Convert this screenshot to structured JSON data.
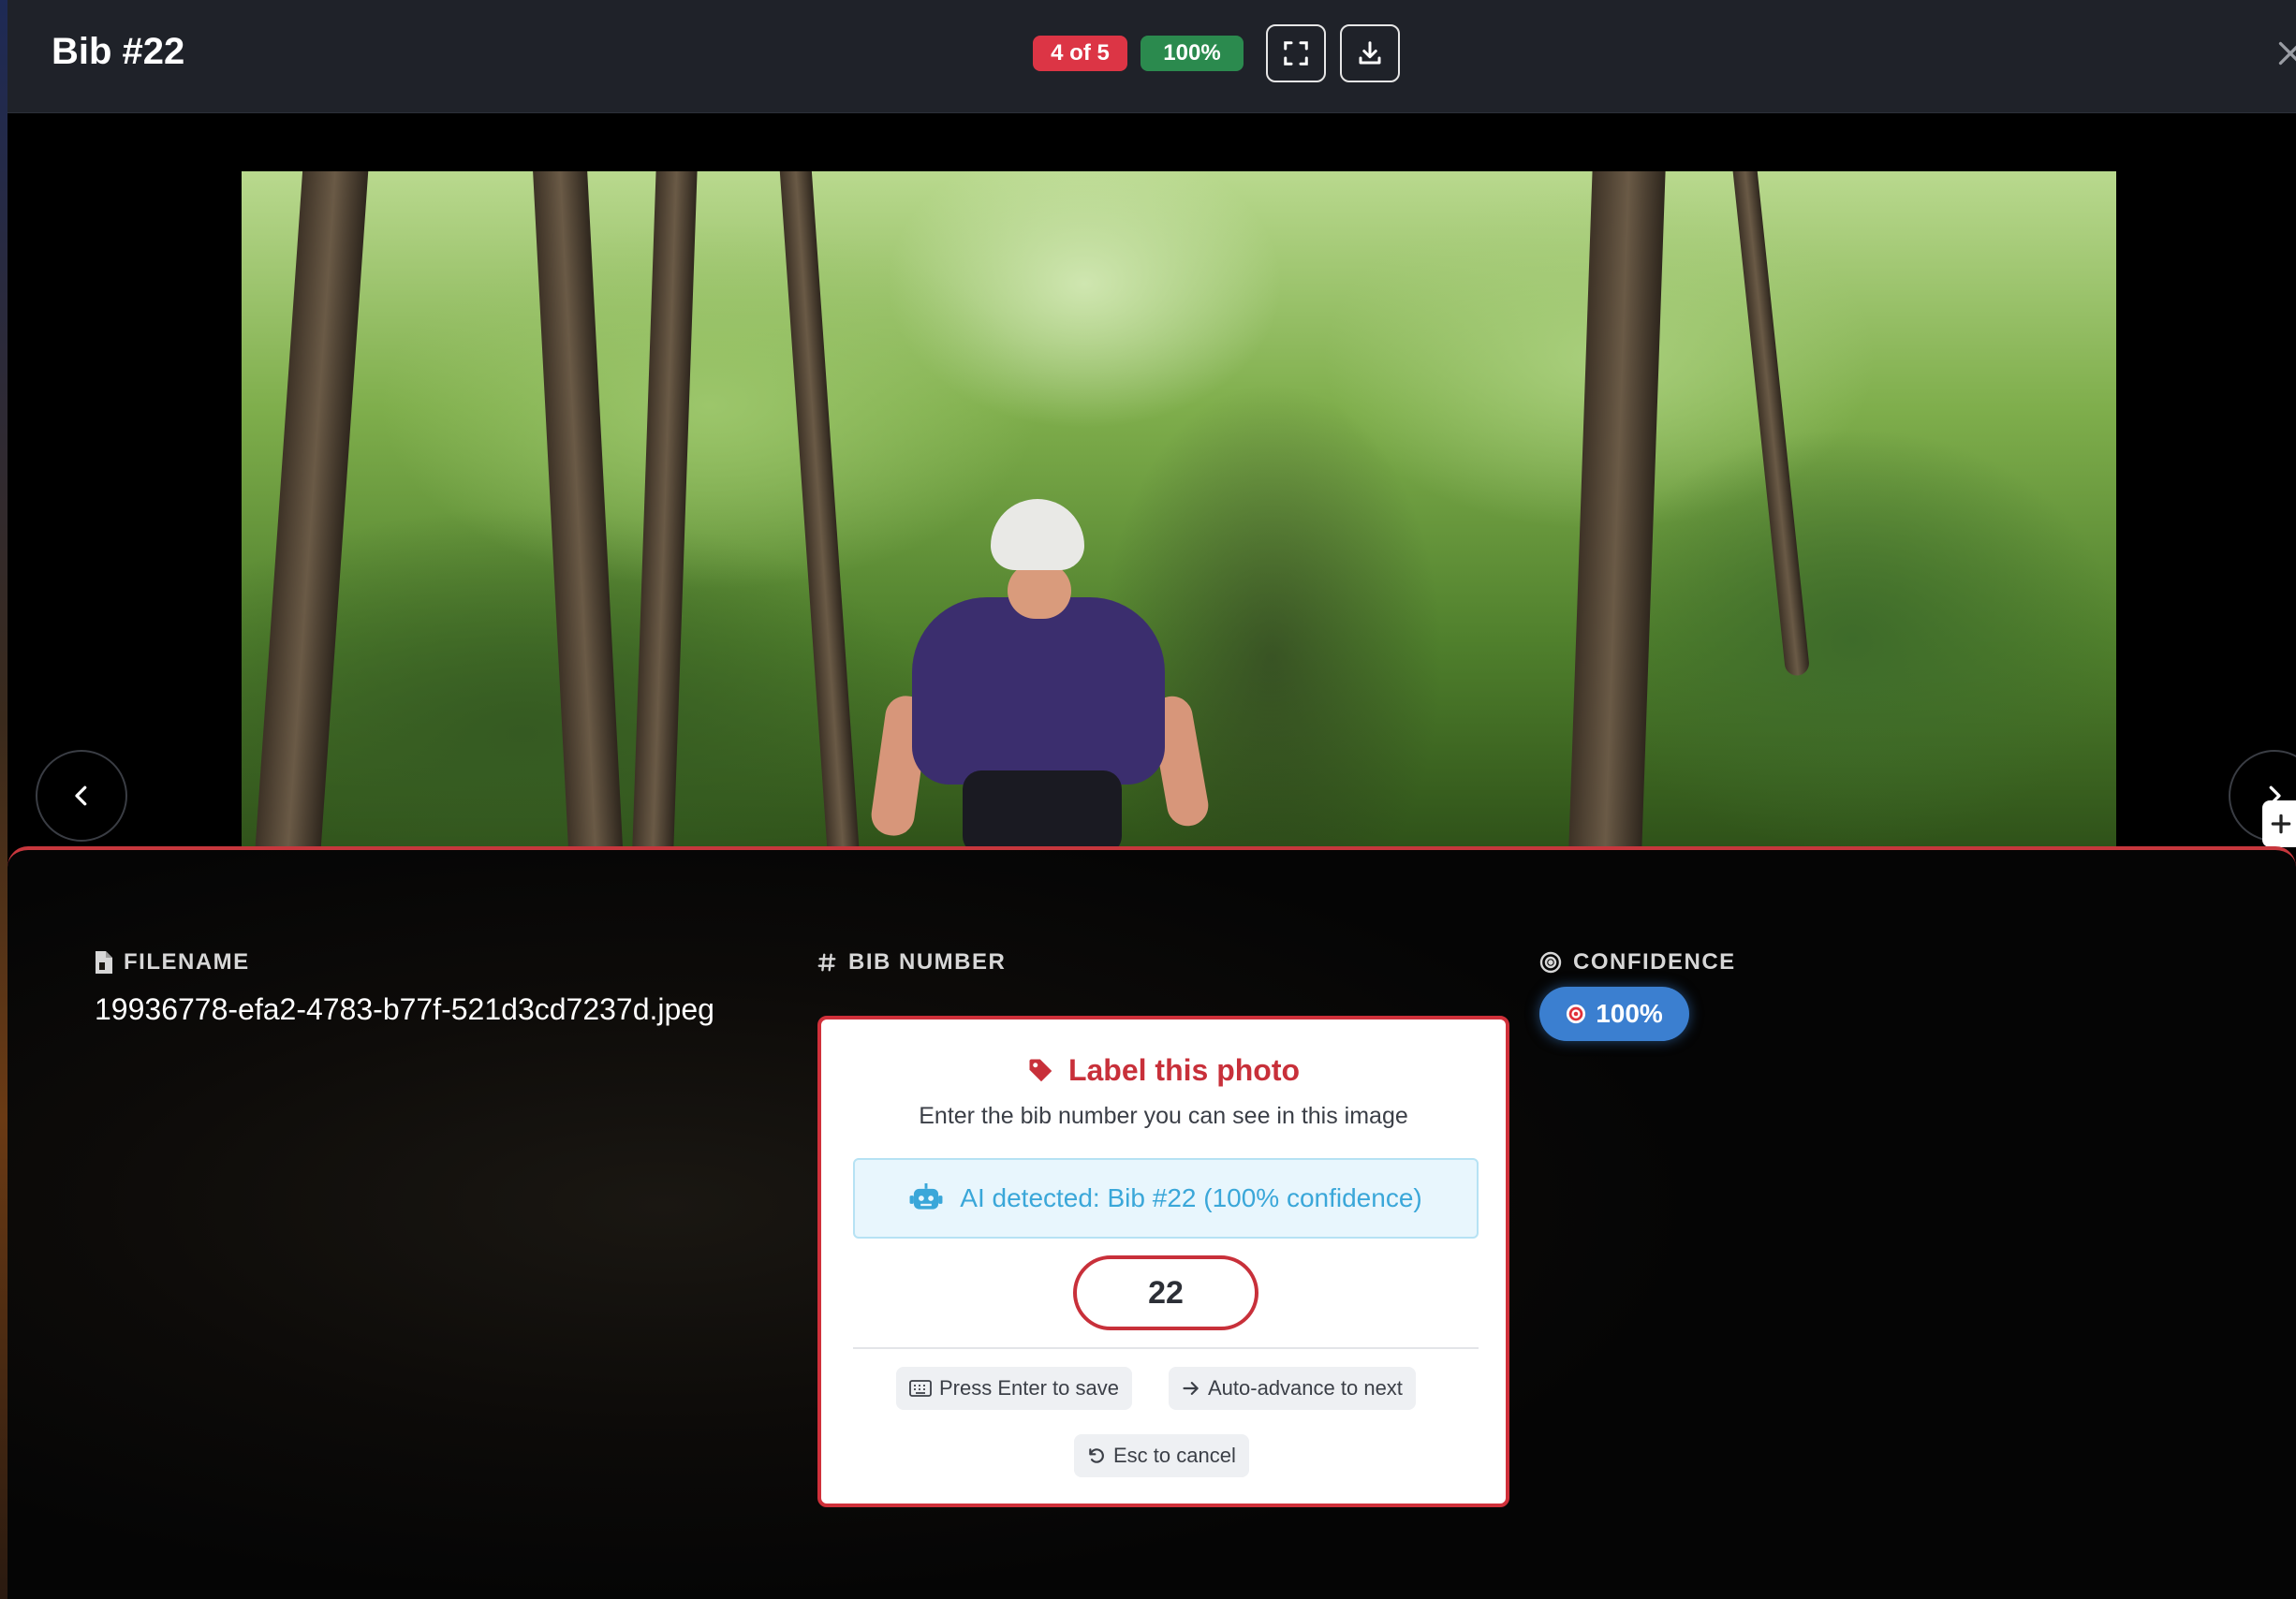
{
  "header": {
    "title": "Bib #22",
    "counter": "4 of 5",
    "confidence_badge": "100%"
  },
  "icons": {
    "fullscreen": "fullscreen-icon",
    "download": "download-icon",
    "close": "close-icon",
    "prev": "chevron-left-icon",
    "next": "chevron-right-icon",
    "plus": "plus-icon"
  },
  "photo": {
    "subject": "cyclist"
  },
  "details": {
    "filename_label": "FILENAME",
    "filename": "19936778-efa2-4783-b77f-521d3cd7237d.jpeg",
    "bib_label": "BIB NUMBER",
    "confidence_label": "CONFIDENCE",
    "confidence_value": "100%"
  },
  "label_card": {
    "title": "Label this photo",
    "subtitle": "Enter the bib number you can see in this image",
    "ai_detected": "AI detected: Bib #22 (100% confidence)",
    "input_value": "22",
    "hint_enter": "Press Enter to save",
    "hint_next": "Auto-advance to next",
    "hint_esc": "Esc to cancel"
  },
  "colors": {
    "accent_red": "#dc3545",
    "success_green": "#2b8a4e",
    "info_blue": "#3b7fd0",
    "ai_text": "#3aa7d9"
  }
}
